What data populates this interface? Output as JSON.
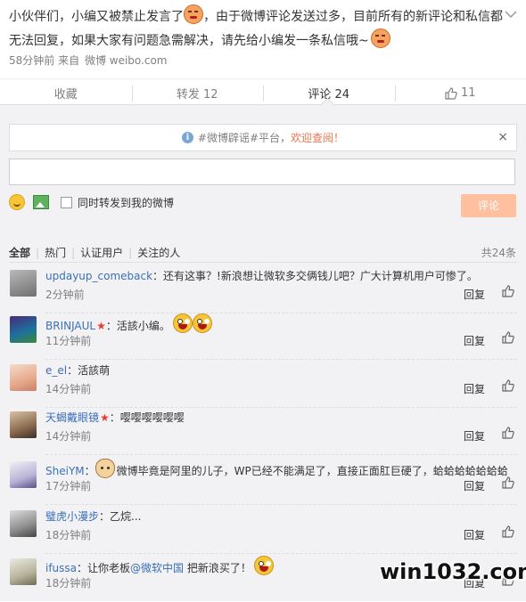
{
  "post": {
    "text_part1": "小伙伴们，小编又被禁止发言了",
    "text_part2": "，由于微博评论发送过多，目前所有的新评论和私信都无法回复，如果大家有问题急需解决，请先给小编发一条私信哦~",
    "time": "58分钟前",
    "source_prefix": "来自",
    "source": "微博 weibo.com",
    "close_icon": "chevron-down-icon"
  },
  "actions": {
    "collect": "收藏",
    "repost": "转发 12",
    "comment": "评论 24",
    "like_count": "11"
  },
  "notice": {
    "text": "#微博辟谣#平台，",
    "link": "欢迎查阅！",
    "close": "×"
  },
  "composer": {
    "checkbox_label": "同时转发到我的微博",
    "submit": "评论"
  },
  "filters": {
    "all": "全部",
    "hot": "热门",
    "verified": "认证用户",
    "following": "关注的人",
    "total": "共24条"
  },
  "comments": [
    {
      "user": "updayup_comeback",
      "text": "：还有这事？!新浪想让微软多交俩钱儿吧？广大计算机用户可惨了。",
      "time": "2分钟前",
      "reply": "回复"
    },
    {
      "user": "BRINJAUL",
      "text": "：活該小编。",
      "time": "11分钟前",
      "reply": "回复"
    },
    {
      "user": "e_el",
      "text": "：活該萌",
      "time": "14分钟前",
      "reply": "回复"
    },
    {
      "user": "天蝎戴眼镜",
      "text": "：嘤嘤嘤嘤嘤嘤",
      "time": "14分钟前",
      "reply": "回复"
    },
    {
      "user": "SheiYM",
      "text": "：",
      "text2": "微博毕竟是阿里的儿子，WP已经不能满足了，直接正面肛巨硬了，蛤蛤蛤蛤蛤蛤蛤",
      "time": "17分钟前",
      "reply": "回复"
    },
    {
      "user": "璧虎小漫步",
      "text": "：乙烷...",
      "time": "18分钟前",
      "reply": "回复"
    },
    {
      "user": "ifussa",
      "text": "：让你老板",
      "mention": "@微软中国",
      "text3": " 把新浪买了！",
      "time": "18分钟前",
      "reply": "回复"
    }
  ],
  "watermark": "win1032.com"
}
